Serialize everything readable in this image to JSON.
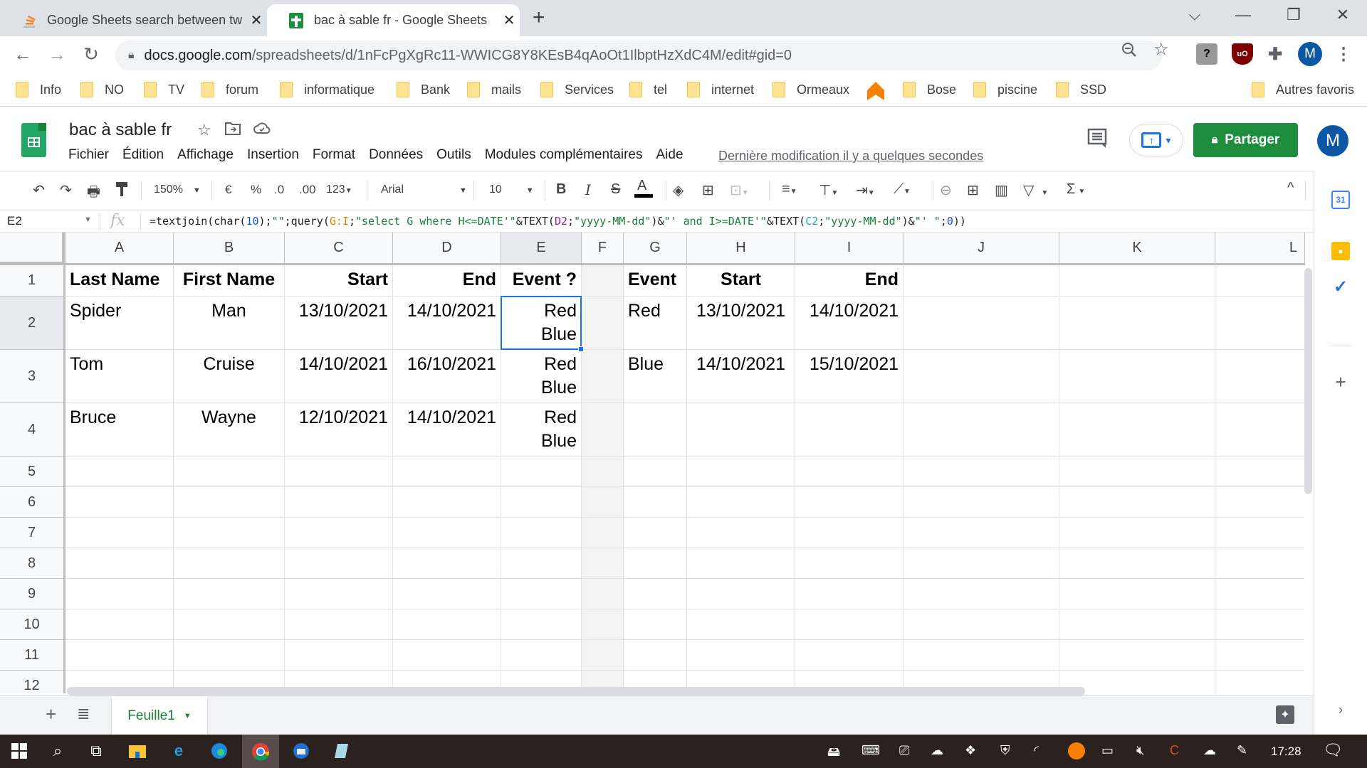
{
  "browser": {
    "tabs": [
      {
        "title": "Google Sheets search between tw",
        "icon": "stackoverflow-icon",
        "active": false
      },
      {
        "title": "bac à sable fr - Google Sheets",
        "icon": "sheets-icon",
        "active": true
      }
    ],
    "new_tab": "+",
    "window_controls": {
      "tabsearch": "⌵",
      "minimize": "—",
      "restore": "❐",
      "close": "✕"
    },
    "url_host": "docs.google.com",
    "url_path": "/spreadsheets/d/1nFcPgXgRc11-WWICG8Y8KEsB4qAoOt1IlbptHzXdC4M/edit#gid=0",
    "profile_initial": "M",
    "bookmarks": [
      "Info",
      "NO",
      "TV",
      "forum",
      "informatique",
      "Bank",
      "mails",
      "Services",
      "tel",
      "internet",
      "Ormeaux",
      "",
      "Bose",
      "piscine",
      "SSD"
    ],
    "other_bookmarks": "Autres favoris"
  },
  "sheets": {
    "doc_title": "bac à sable fr",
    "menu": [
      "Fichier",
      "Édition",
      "Affichage",
      "Insertion",
      "Format",
      "Données",
      "Outils",
      "Modules complémentaires",
      "Aide"
    ],
    "last_modified": "Dernière modification il y a quelques secondes",
    "share_label": "Partager",
    "avatar_initial": "M",
    "toolbar": {
      "zoom": "150%",
      "currency": "€",
      "percent": "%",
      "decrease_decimals": ".0",
      "increase_decimals": ".00",
      "number_format": "123",
      "font": "Arial",
      "font_size": "10",
      "bold": "B",
      "italic": "I",
      "strikethrough": "S",
      "text_color": "A",
      "functions": "Σ"
    },
    "formula_bar": {
      "cell_ref": "E2",
      "fx": "fx",
      "formula_parts": [
        {
          "t": "=textjoin(char(",
          "c": ""
        },
        {
          "t": "10",
          "c": "f-num"
        },
        {
          "t": ");",
          "c": ""
        },
        {
          "t": "\"\"",
          "c": "f-str"
        },
        {
          "t": ";query(",
          "c": ""
        },
        {
          "t": "G:I",
          "c": "f-rng1"
        },
        {
          "t": ";",
          "c": ""
        },
        {
          "t": "\"select G where H<=DATE'\"",
          "c": "f-str"
        },
        {
          "t": "&TEXT(",
          "c": ""
        },
        {
          "t": "D2",
          "c": "f-rng2"
        },
        {
          "t": ";",
          "c": ""
        },
        {
          "t": "\"yyyy-MM-dd\"",
          "c": "f-str"
        },
        {
          "t": ")&",
          "c": ""
        },
        {
          "t": "\"' and I>=DATE'\"",
          "c": "f-str"
        },
        {
          "t": "&TEXT(",
          "c": ""
        },
        {
          "t": "C2",
          "c": "f-rng3"
        },
        {
          "t": ";",
          "c": ""
        },
        {
          "t": "\"yyyy-MM-dd\"",
          "c": "f-str"
        },
        {
          "t": ")&",
          "c": ""
        },
        {
          "t": "\"' \"",
          "c": "f-str"
        },
        {
          "t": ";",
          "c": ""
        },
        {
          "t": "0",
          "c": "f-num"
        },
        {
          "t": "))",
          "c": ""
        }
      ]
    },
    "columns": [
      "A",
      "B",
      "C",
      "D",
      "E",
      "F",
      "G",
      "H",
      "I",
      "J",
      "K",
      "L"
    ],
    "selected_column": "E",
    "rows": [
      "1",
      "2",
      "3",
      "4",
      "5",
      "6",
      "7",
      "8",
      "9",
      "10",
      "11",
      "12"
    ],
    "selected_row": "2",
    "cells": {
      "A1": "Last Name",
      "B1": "First Name",
      "C1": "Start",
      "D1": "End",
      "E1": "Event ?",
      "G1": "Event",
      "H1": "Start",
      "I1": "End",
      "A2": "Spider",
      "B2": "Man",
      "C2": "13/10/2021",
      "D2": "14/10/2021",
      "E2": "Red\nBlue",
      "G2": "Red",
      "H2": "13/10/2021",
      "I2": "14/10/2021",
      "A3": "Tom",
      "B3": "Cruise",
      "C3": "14/10/2021",
      "D3": "16/10/2021",
      "E3": "Red\nBlue",
      "G3": "Blue",
      "H3": "14/10/2021",
      "I3": "15/10/2021",
      "A4": "Bruce",
      "B4": "Wayne",
      "C4": "12/10/2021",
      "D4": "14/10/2021",
      "E4": "Red\nBlue"
    },
    "selected_cell": "E2",
    "sheet_tab": "Feuille1"
  },
  "taskbar": {
    "clock": "17:28"
  }
}
